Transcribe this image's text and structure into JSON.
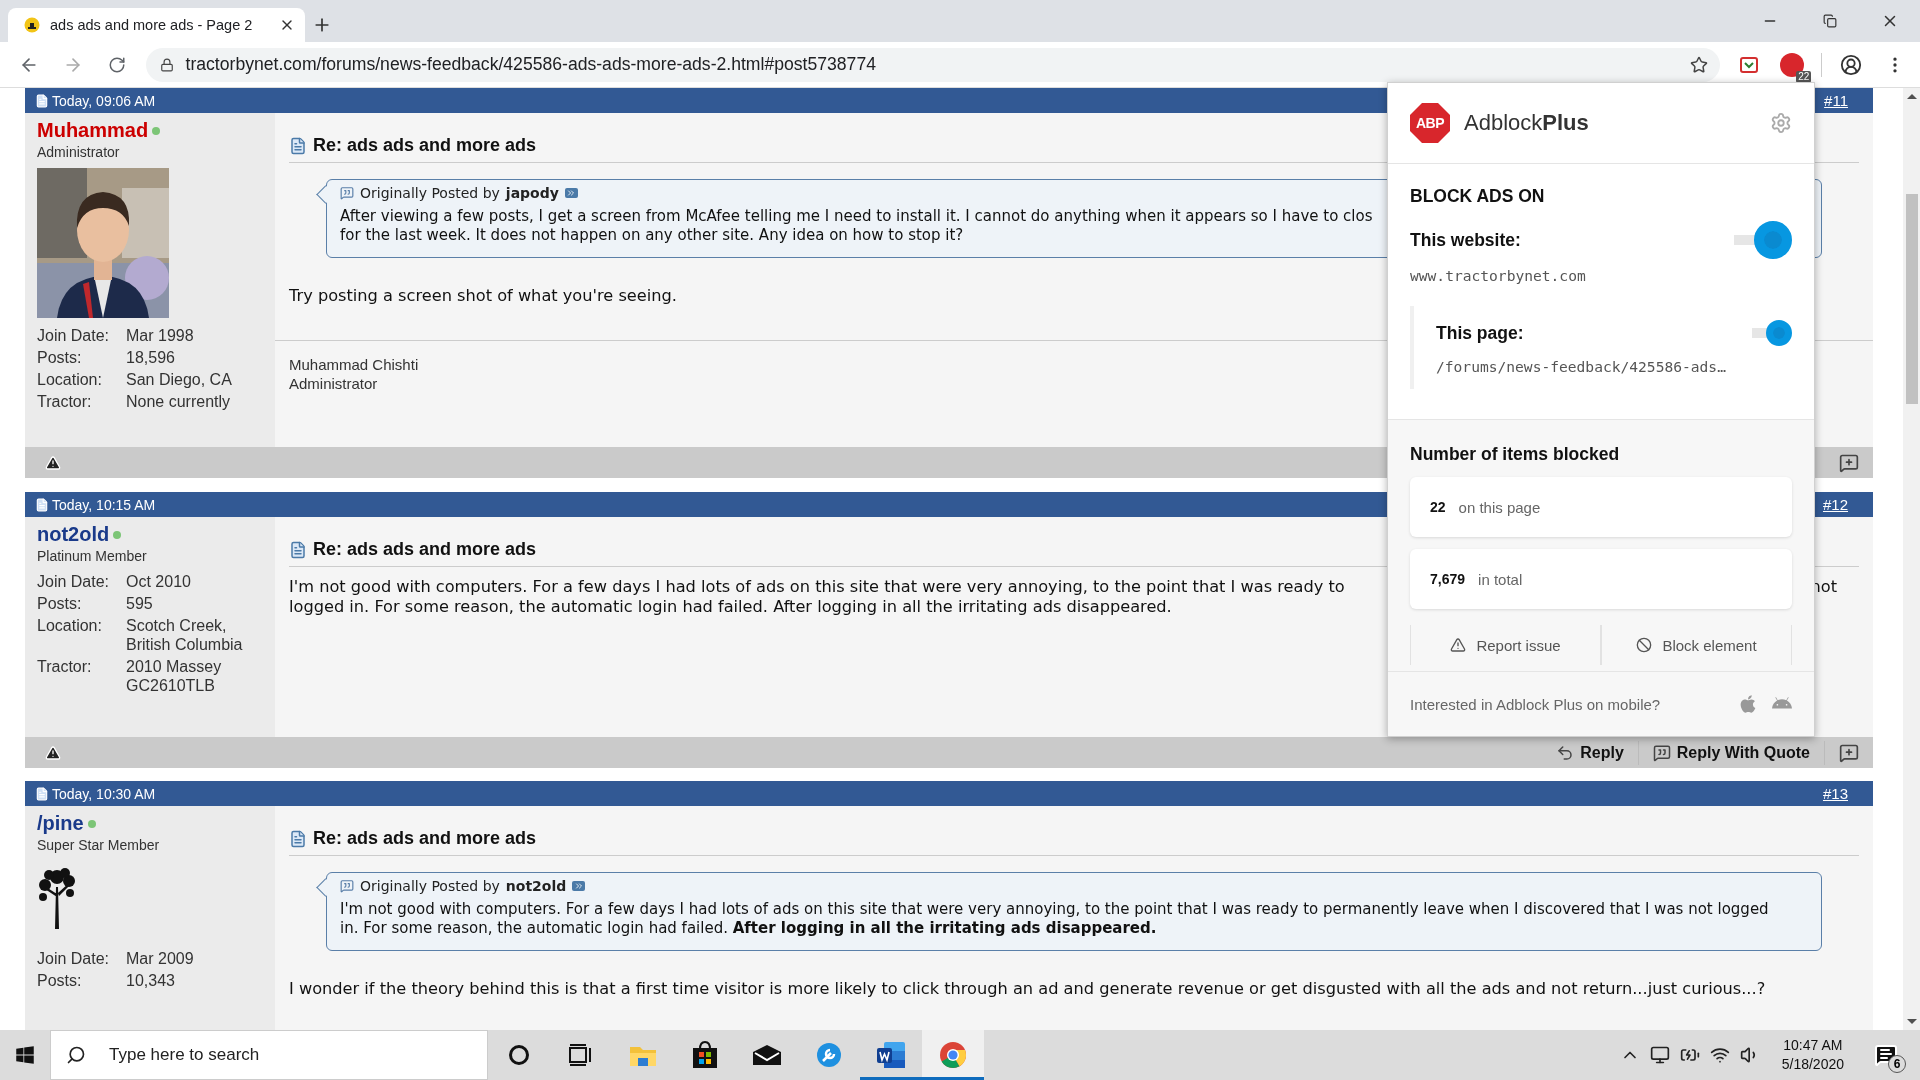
{
  "tabs": [
    {
      "title": "ads ads and more ads - Page 2",
      "selected": true
    }
  ],
  "address": {
    "url": "tractorbynet.com/forums/news-feedback/425586-ads-ads-more-ads-2.html#post5738774"
  },
  "extension_badge": "22",
  "posts": [
    {
      "date": "Today, 09:06 AM",
      "number": "#11",
      "user": {
        "name": "Muhammad",
        "color": "#cc0000",
        "online": true,
        "rank": "Administrator",
        "stats": [
          {
            "label": "Join Date:",
            "value": [
              "Mar 1998"
            ]
          },
          {
            "label": "Posts:",
            "value": [
              "18,596"
            ]
          },
          {
            "label": "Location:",
            "value": [
              "San Diego, CA"
            ]
          },
          {
            "label": "Tractor:",
            "value": [
              "None currently"
            ]
          }
        ]
      },
      "title": "Re: ads ads and more ads",
      "quote": {
        "by": "Originally Posted by",
        "author": "japody",
        "lines": [
          "After viewing a few posts, I get a screen from McAfee telling me I need to install it. I cannot do anything when it appears so I have to clos",
          "for the last week. It does not happen on any other site. Any idea on how to stop it?"
        ]
      },
      "body": [
        {
          "text": "Try posting a screen shot of what you're seeing."
        }
      ],
      "signature": [
        "Muhammad Chishti",
        "Administrator"
      ],
      "footer": {
        "shown": true
      }
    },
    {
      "date": "Today, 10:15 AM",
      "number": "#12",
      "user": {
        "name": "not2old",
        "color": "#1a3a8a",
        "online": true,
        "rank": "Platinum Member",
        "stats": [
          {
            "label": "Join Date:",
            "value": [
              "Oct 2010"
            ]
          },
          {
            "label": "Posts:",
            "value": [
              "595"
            ]
          },
          {
            "label": "Location:",
            "value": [
              "Scotch Creek,",
              "British Columbia"
            ]
          },
          {
            "label": "Tractor:",
            "value": [
              "2010 Massey",
              "GC2610TLB"
            ]
          }
        ]
      },
      "title": "Re: ads ads and more ads",
      "body": [
        {
          "text": "I'm not good with computers. For a few days I had lots of ads on this site that were very annoying, to the point that I was ready to",
          "end": "not"
        },
        {
          "text": "logged in. For some reason, the automatic login had failed. After logging in all the irritating ads disappeared."
        }
      ],
      "footer": {
        "shown": true,
        "buttons": [
          {
            "kind": "reply",
            "label": "Reply"
          },
          {
            "kind": "quote",
            "label": "Reply With Quote"
          }
        ]
      }
    },
    {
      "date": "Today, 10:30 AM",
      "number": "#13",
      "user": {
        "name": "/pine",
        "color": "#1a3a8a",
        "online": true,
        "rank": "Super Star Member",
        "avatar": {
          "kind": "tree"
        },
        "stats": [
          {
            "label": "Join Date:",
            "value": [
              "Mar 2009"
            ]
          },
          {
            "label": "Posts:",
            "value": [
              "10,343"
            ]
          }
        ]
      },
      "title": "Re: ads ads and more ads",
      "quote": {
        "by": "Originally Posted by",
        "author": "not2old",
        "lines": [
          "I'm not good with computers. For a few days I had lots of ads on this site that were very annoying, to the point that I was ready to permanently leave when I discovered that I was not logged",
          "in. For some reason, the automatic login had failed. **After logging in all the irritating ads disappeared.**"
        ]
      },
      "body": [
        {
          "text": "I wonder if the theory behind this is that a first time visitor is more likely to click through an ad and generate revenue or get disgusted with all the ads and not return...just curious...?"
        }
      ]
    }
  ],
  "popup": {
    "logo": "ABP",
    "title": "Adblock**Plus**",
    "heading": "BLOCK ADS ON",
    "website": {
      "label": "This website:",
      "domain": "www.tractorbynet.com",
      "on": true
    },
    "page": {
      "label": "This page:",
      "path": "/forums/news-feedback/425586-ads…",
      "on": true
    },
    "blocked_heading": "Number of items blocked",
    "counts": [
      {
        "value": "22",
        "label": "on this page"
      },
      {
        "value": "7,679",
        "label": "in total"
      }
    ],
    "actions": [
      {
        "kind": "report",
        "label": "Report issue"
      },
      {
        "kind": "block",
        "label": "Block element"
      }
    ],
    "mobile": "Interested in Adblock Plus on mobile?"
  },
  "taskbar": {
    "search_placeholder": "Type here to search",
    "apps": [
      {
        "kind": "cortana",
        "active": false,
        "focused": false
      },
      {
        "kind": "taskview",
        "active": false,
        "focused": false
      },
      {
        "kind": "explorer",
        "active": false,
        "focused": false
      },
      {
        "kind": "store",
        "active": false,
        "focused": false
      },
      {
        "kind": "mail",
        "active": false,
        "focused": false
      },
      {
        "kind": "wrench",
        "active": false,
        "focused": false
      },
      {
        "kind": "word",
        "active": true,
        "focused": false
      },
      {
        "kind": "browser",
        "active": true,
        "focused": true
      }
    ],
    "time": "10:47 AM",
    "date": "5/18/2020",
    "notifications": "6"
  }
}
